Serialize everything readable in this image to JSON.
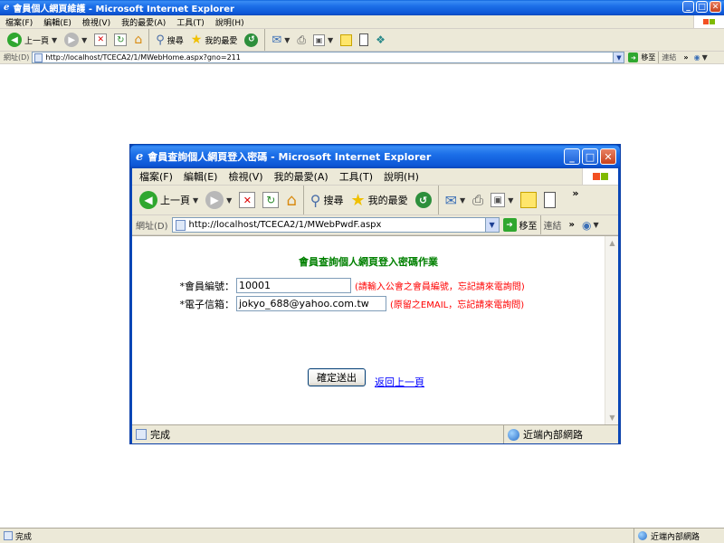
{
  "outer": {
    "title": "會員個人網頁維護 - Microsoft Internet Explorer",
    "menu": [
      "檔案(F)",
      "編輯(E)",
      "檢視(V)",
      "我的最愛(A)",
      "工具(T)",
      "說明(H)"
    ],
    "toolbar": {
      "back": "上一頁",
      "search": "搜尋",
      "favorites": "我的最愛"
    },
    "address_label": "網址(D)",
    "url": "http://localhost/TCECA2/1/MWebHome.aspx?gno=211",
    "go": "移至",
    "links": "連結",
    "status_text": "完成",
    "zone": "近端內部網路"
  },
  "popup": {
    "title": "會員查詢個人網頁登入密碼 - Microsoft Internet Explorer",
    "menu": [
      "檔案(F)",
      "編輯(E)",
      "檢視(V)",
      "我的最愛(A)",
      "工具(T)",
      "說明(H)"
    ],
    "toolbar": {
      "back": "上一頁",
      "search": "搜尋",
      "favorites": "我的最愛"
    },
    "address_label": "網址(D)",
    "url": "http://localhost/TCECA2/1/MWebPwdF.aspx",
    "go": "移至",
    "links": "連結",
    "status_text": "完成",
    "zone": "近端內部網路"
  },
  "form": {
    "title": "會員查詢個人網頁登入密碼作業",
    "member_no_label": "*會員編號：",
    "member_no_value": "10001",
    "member_no_hint": "(請輸入公會之會員編號，忘記請來電詢問)",
    "email_label": "*電子信箱：",
    "email_value": "jokyo_688@yahoo.com.tw",
    "email_hint": "(原留之EMAIL，忘記請來電詢問)",
    "submit": "確定送出",
    "back_link": "返回上一頁"
  },
  "colors": {
    "title_bar": "#0a5fd8",
    "chrome": "#ece9d8",
    "form_title": "#008000",
    "hint": "#ff0000",
    "link": "#0000ff"
  }
}
